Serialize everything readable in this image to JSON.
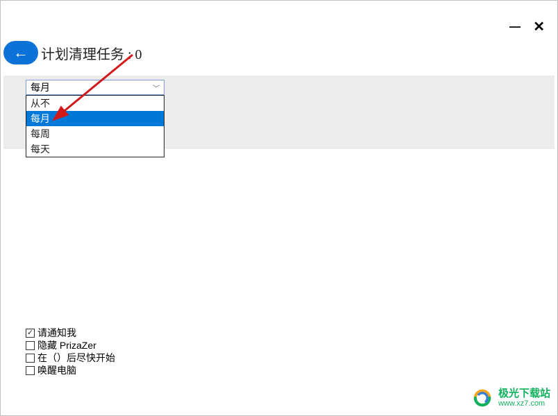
{
  "header": {
    "title": "计划清理任务 : 0"
  },
  "dropdown": {
    "selected": "每月",
    "options": [
      "从不",
      "每月",
      "每周",
      "每天"
    ]
  },
  "checkboxes": {
    "notify": {
      "label": "请通知我",
      "checked": true
    },
    "hide": {
      "label": "隐藏 PrizaZer",
      "checked": false
    },
    "start_after": {
      "label": "在（）后尽快开始",
      "checked": false
    },
    "wake": {
      "label": "唤醒电脑",
      "checked": false
    }
  },
  "watermark": {
    "title": "极光下载站",
    "url": "www.xz7.com"
  }
}
